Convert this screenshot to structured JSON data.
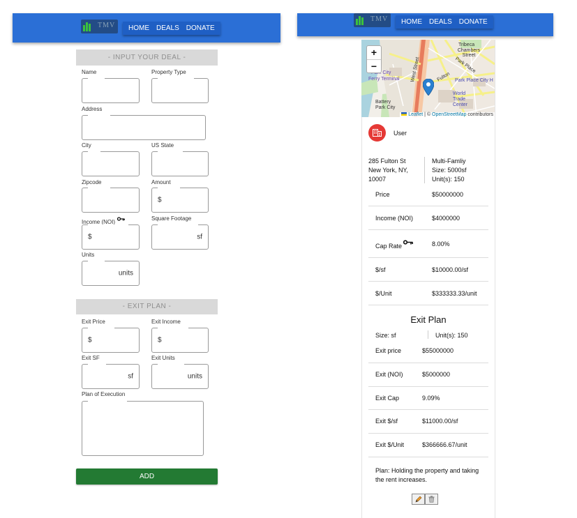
{
  "brand": {
    "logo_text": "TMV"
  },
  "nav": {
    "items": [
      "HOME",
      "DEALS",
      "DONATE"
    ]
  },
  "form": {
    "section1_title": "- INPUT YOUR DEAL -",
    "name_label": "Name",
    "property_type_label": "Property Type",
    "address_label": "Address",
    "city_label": "City",
    "state_label": "US State",
    "zipcode_label": "Zipcode",
    "amount_label": "Amount",
    "amount_prefix": "$",
    "income_label": "Income (NOI)",
    "income_prefix": "$",
    "sqft_label": "Square Footage",
    "sqft_suffix": "sf",
    "units_label": "Units",
    "units_suffix": "units",
    "section2_title": "- EXIT PLAN -",
    "exit_price_label": "Exit Price",
    "exit_price_prefix": "$",
    "exit_income_label": "Exit Income",
    "exit_income_prefix": "$",
    "exit_sf_label": "Exit SF",
    "exit_sf_suffix": "sf",
    "exit_units_label": "Exit Units",
    "exit_units_suffix": "units",
    "plan_label": "Plan of Execution",
    "add_label": "ADD"
  },
  "map": {
    "zoom_in": "+",
    "zoom_out": "−",
    "leaflet": "Leaflet",
    "separator": " | © ",
    "osm": "OpenStreetMap",
    "contributors": " contributors",
    "place_labels": [
      "Tribeca",
      "Chambers Street",
      "Park Place City H",
      "World Trade Center",
      "Battery Park City",
      "Park City",
      "Ferry Terminal",
      "West Street",
      "Park Place",
      "Fulton"
    ]
  },
  "deal": {
    "user": "User",
    "address_line1": "285 Fulton St",
    "address_line2": "New York, NY,",
    "address_line3": "10007",
    "type": "Multi-Famliy",
    "size": "Size: 5000sf",
    "units": "Unit(s): 150",
    "metrics": [
      {
        "label": "Price",
        "value": "$50000000"
      },
      {
        "label": "Income (NOI)",
        "value": "$4000000"
      },
      {
        "label": "Cap Rate",
        "value": "8.00%"
      },
      {
        "label": "$/sf",
        "value": "$10000.00/sf"
      },
      {
        "label": "$/Unit",
        "value": "$333333.33/unit"
      }
    ],
    "exit_title": "Exit Plan",
    "exit_size": "Size: sf",
    "exit_units": "Unit(s): 150",
    "exit_metrics": [
      {
        "label": "Exit price",
        "value": "$55000000"
      },
      {
        "label": "Exit (NOI)",
        "value": "$5000000"
      },
      {
        "label": "Exit Cap",
        "value": "9.09%"
      },
      {
        "label": "Exit $/sf",
        "value": "$11000.00/sf"
      },
      {
        "label": "Exit $/Unit",
        "value": "$366666.67/unit"
      }
    ],
    "plan_line1": "Plan: Holding the property and taking",
    "plan_line2": "the rent increases."
  },
  "colors": {
    "navbar": "#2b6fd6",
    "add_button": "#237a33",
    "avatar": "#e53935",
    "map_pin": "#2a80d0"
  }
}
